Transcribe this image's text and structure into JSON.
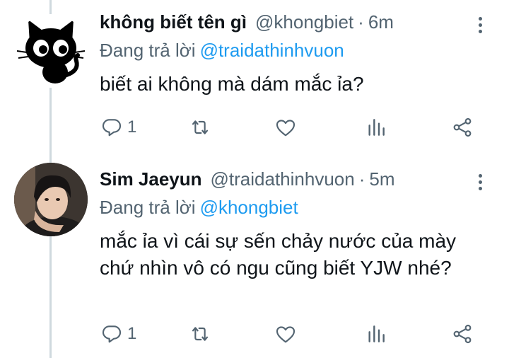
{
  "tweets": [
    {
      "display_name": "không biết tên gì",
      "handle": "@khongbiet",
      "separator": "·",
      "time": "6m",
      "reply_prefix": "Đang trả lời",
      "reply_to": "@traidathinhvuon",
      "text": "biết ai không mà dám mắc ỉa?",
      "reply_count": "1",
      "avatar": "black-cat-avatar"
    },
    {
      "display_name": "Sim Jaeyun",
      "handle": "@traidathinhvuon",
      "separator": "·",
      "time": "5m",
      "reply_prefix": "Đang trả lời",
      "reply_to": "@khongbiet",
      "text": "mắc ỉa vì cái sự sến chảy nước của mày chứ nhìn vô có ngu cũng biết YJW nhé?",
      "reply_count": "1",
      "avatar": "person-photo-avatar"
    }
  ],
  "colors": {
    "text": "#0f1419",
    "secondary": "#536471",
    "link": "#1d9bf0",
    "thread_line": "#cfd9de"
  },
  "icons": [
    "reply-icon",
    "retweet-icon",
    "like-icon",
    "views-icon",
    "share-icon",
    "more-icon"
  ]
}
